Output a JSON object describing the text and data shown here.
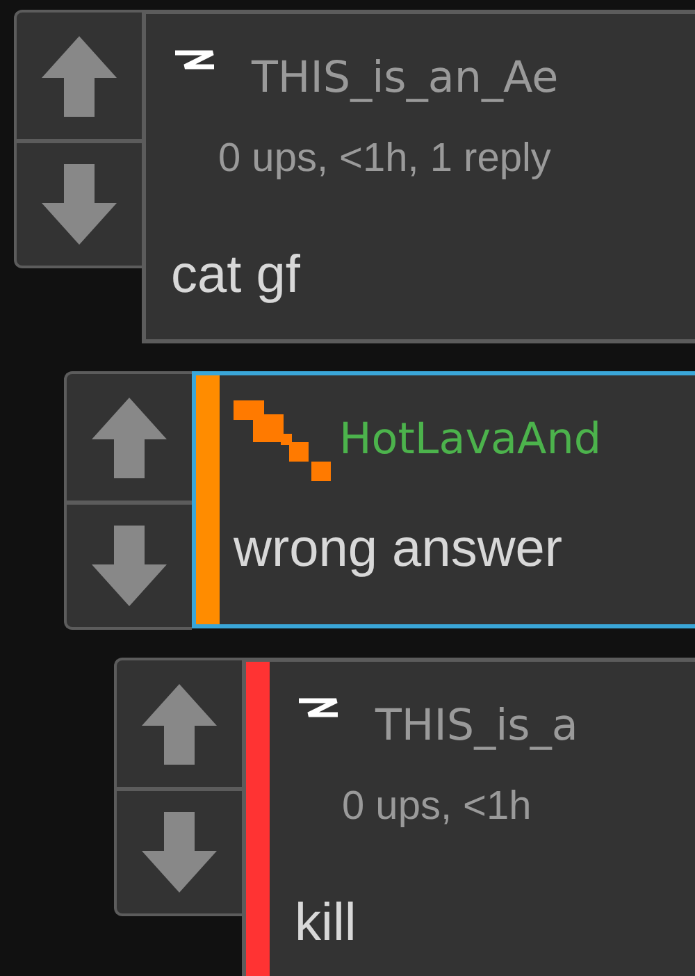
{
  "comments": [
    {
      "kind": "standard",
      "username": "THIS_is_an_Ae",
      "meta": "0 ups, <1h, 1 reply",
      "body": "cat gf",
      "highlighted": false,
      "children": [
        {
          "kind": "flame",
          "username": "HotLavaAnd",
          "color": "#ff8c00",
          "body": "wrong answer",
          "highlighted": true,
          "children": [
            {
              "kind": "standard",
              "username": "THIS_is_a",
              "meta": "0 ups, <1h",
              "color": "#ff3333",
              "body": "kill",
              "highlighted": false
            }
          ]
        }
      ]
    }
  ]
}
